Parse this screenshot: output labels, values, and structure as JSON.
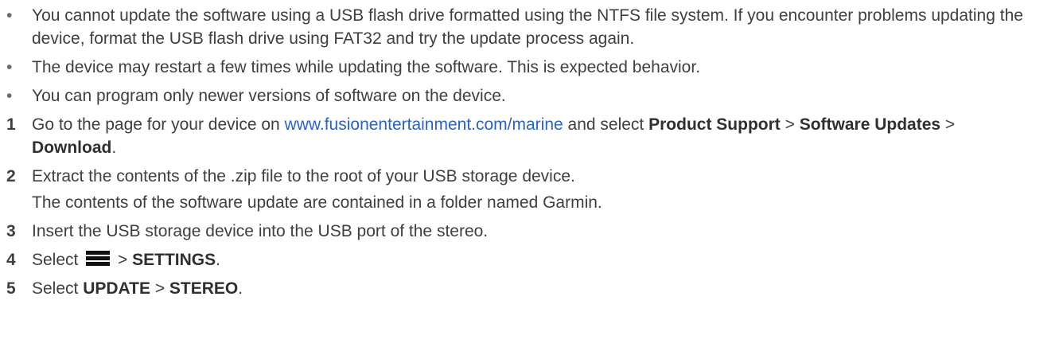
{
  "bullets": [
    "You cannot update the software using a USB flash drive formatted using the NTFS file system. If you encounter problems updating the device, format the USB flash drive using FAT32 and try the update process again.",
    "The device may restart a few times while updating the software. This is expected behavior.",
    "You can program only newer versions of software on the device."
  ],
  "bullet_symbol": "•",
  "steps": [
    {
      "num": "1",
      "pre": "Go to the page for your device on ",
      "link": "www.fusionentertainment.com/marine",
      "mid1": " and select ",
      "b1": "Product Support",
      "sep1": " > ",
      "b2": "Software Updates",
      "sep2": " > ",
      "b3": "Download",
      "end": "."
    },
    {
      "num": "2",
      "text": "Extract the contents of the .zip file to the root of your USB storage device.",
      "note": "The contents of the software update are contained in a folder named Garmin."
    },
    {
      "num": "3",
      "text": "Insert the USB storage device into the USB port of the stereo."
    },
    {
      "num": "4",
      "pre": "Select ",
      "icon": "menu-icon",
      "sep": " > ",
      "b1": "SETTINGS",
      "end": "."
    },
    {
      "num": "5",
      "pre": "Select ",
      "b1": "UPDATE",
      "sep": " > ",
      "b2": "STEREO",
      "end": "."
    }
  ]
}
